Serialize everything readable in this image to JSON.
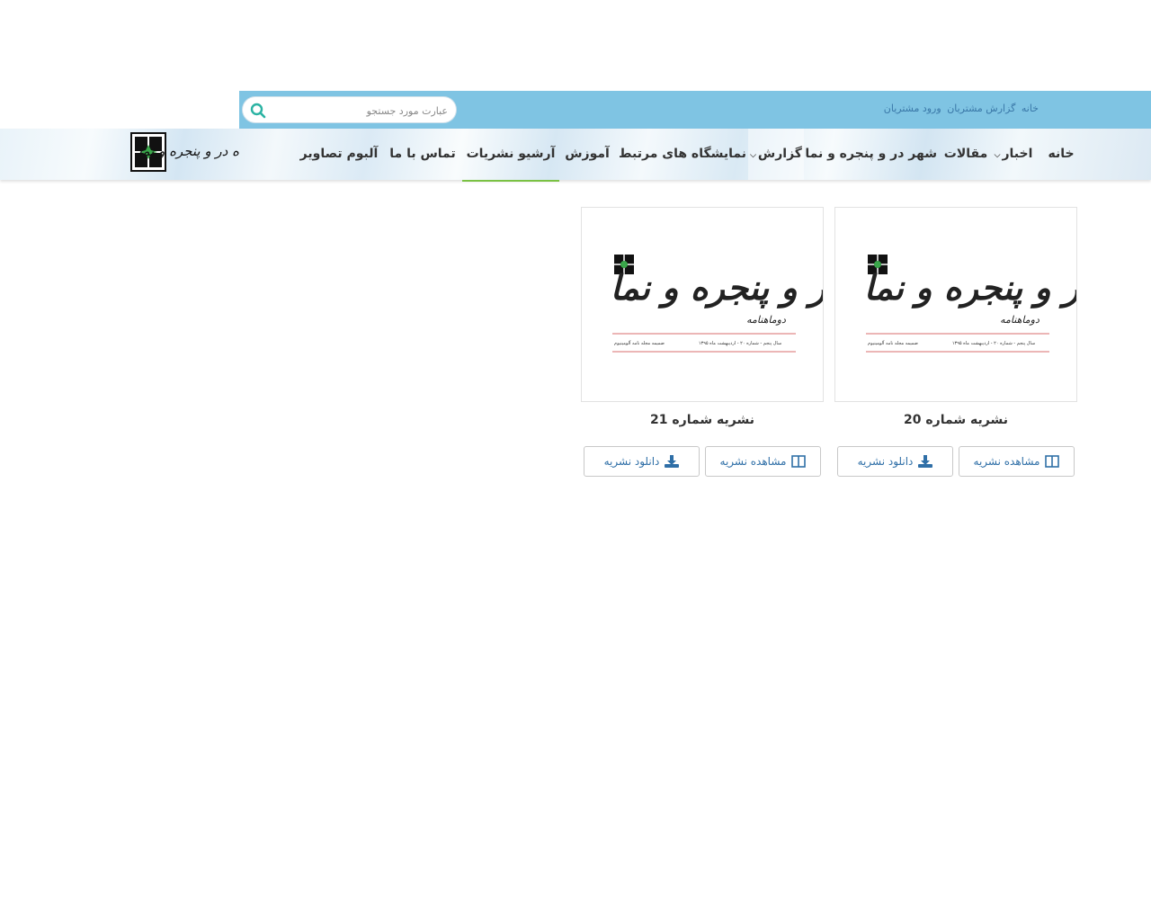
{
  "topbar": {
    "links": [
      "خانه",
      "گزارش مشتریان",
      "ورود مشتریان"
    ],
    "search": {
      "placeholder": "عبارت مورد جستجو"
    }
  },
  "nav": {
    "items": [
      {
        "label": "خانه"
      },
      {
        "label": "اخبار",
        "dropdown": true
      },
      {
        "label": "مقالات"
      },
      {
        "label": "شهر در و پنجره و نما"
      },
      {
        "label": "گزارش",
        "dropdown": true
      },
      {
        "label": "نمایشگاه های مرتبط"
      },
      {
        "label": "آموزش"
      },
      {
        "label": "آرشیو نشریات",
        "active": true
      },
      {
        "label": "تماس با ما"
      },
      {
        "label": "آلبوم تصاویر"
      }
    ],
    "logo_text": "باشگاه در و پنجره و نما"
  },
  "cards": [
    {
      "title": "نشریه شماره 20",
      "view_label": "مشاهده نشریه",
      "download_label": "دانلود نشریه",
      "cover": {
        "title": "در و پنجره و نما",
        "subtitle": "دوماهنامه",
        "issue_line": "سال پنجم - شماره ۲۰ - اردیبهشت ماه ۱۳۹۵",
        "footer_right": "ضمیمه مجله نامه آلومینیوم"
      }
    },
    {
      "title": "نشریه شماره 21",
      "view_label": "مشاهده نشریه",
      "download_label": "دانلود نشریه",
      "cover": {
        "title": "در و پنجره و نما",
        "subtitle": "دوماهنامه",
        "issue_line": "سال پنجم - شماره ۲۰ - اردیبهشت ماه ۱۳۹۵",
        "footer_right": "ضمیمه مجله نامه آلومینیوم"
      }
    }
  ],
  "colors": {
    "topbar": "#7fc4e3",
    "accent": "#7ac143",
    "link": "#2f6fa7",
    "search_icon": "#2bb3a3"
  }
}
